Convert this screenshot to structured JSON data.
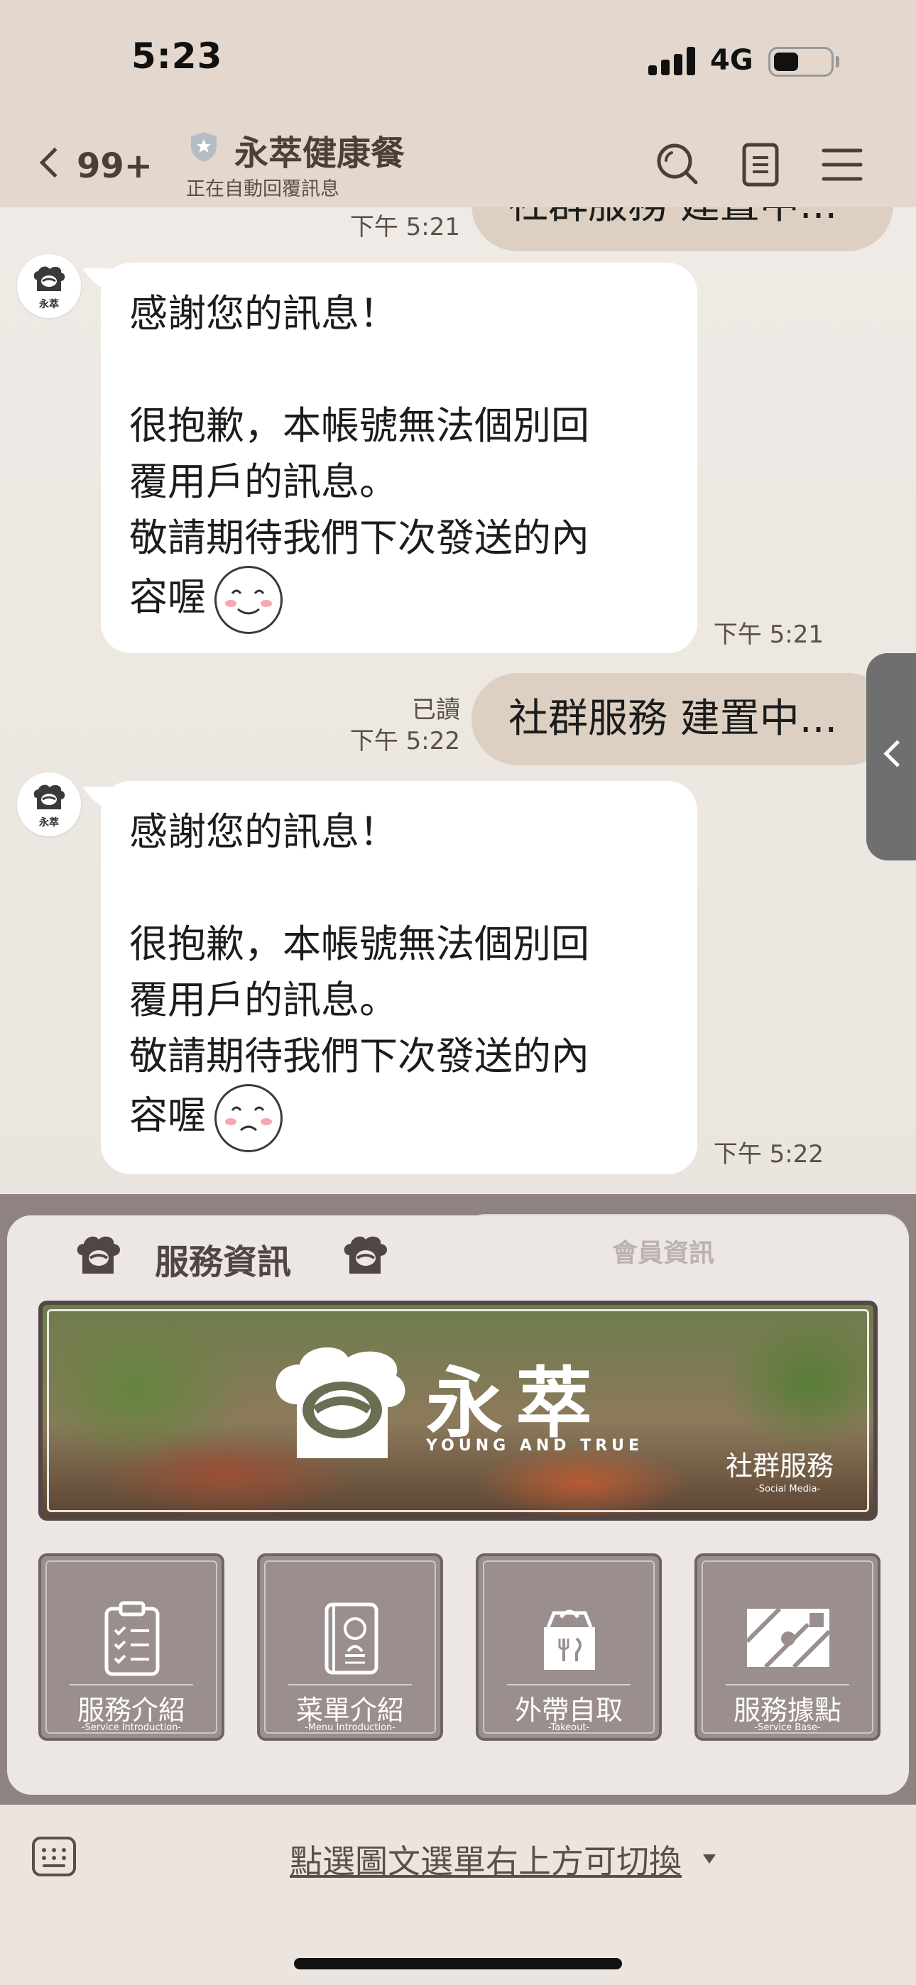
{
  "status_bar": {
    "time": "5:23",
    "network": "4G"
  },
  "header": {
    "unread_count": "99+",
    "title": "永萃健康餐",
    "subtitle": "正在自動回覆訊息"
  },
  "chat": {
    "top_partial_time": "下午 5:21",
    "top_partial_message": "社群服務 建置中...",
    "messages": [
      {
        "sender": "account",
        "avatar_text": "永萃",
        "lines": [
          "感謝您的訊息！",
          "",
          "很抱歉，本帳號無法個別回",
          "覆用戶的訊息。",
          "敬請期待我們下次發送的內",
          "容喔"
        ],
        "time": "下午 5:21"
      },
      {
        "sender": "me",
        "read": "已讀",
        "text": "社群服務 建置中...",
        "time": "下午 5:22"
      },
      {
        "sender": "account",
        "avatar_text": "永萃",
        "lines": [
          "感謝您的訊息！",
          "",
          "很抱歉，本帳號無法個別回",
          "覆用戶的訊息。",
          "敬請期待我們下次發送的內",
          "容喔"
        ],
        "time": "下午 5:22"
      }
    ]
  },
  "rich_menu": {
    "active_tab": "服務資訊",
    "other_tab": "會員資訊",
    "banner": {
      "brand_name": "永萃",
      "brand_en": "YOUNG AND TRUE",
      "label": "社群服務",
      "sub": "-Social Media-"
    },
    "buttons": [
      {
        "label": "服務介紹",
        "sub": "-Service Introduction-",
        "icon": "clipboard-list-icon"
      },
      {
        "label": "菜單介紹",
        "sub": "-Menu Introduction-",
        "icon": "menu-book-icon"
      },
      {
        "label": "外帶自取",
        "sub": "-Takeout-",
        "icon": "takeout-box-icon"
      },
      {
        "label": "服務據點",
        "sub": "-Service Base-",
        "icon": "map-location-icon"
      }
    ]
  },
  "bottom_bar": {
    "toggle_label": "點選圖文選單右上方可切換"
  },
  "colors": {
    "header_bg": "#e4d8ce",
    "outgoing_bubble": "#ddd0c2",
    "incoming_bubble": "#ffffff",
    "rich_menu_frame": "#8e8382",
    "rich_menu_button": "#9a8f8e"
  }
}
